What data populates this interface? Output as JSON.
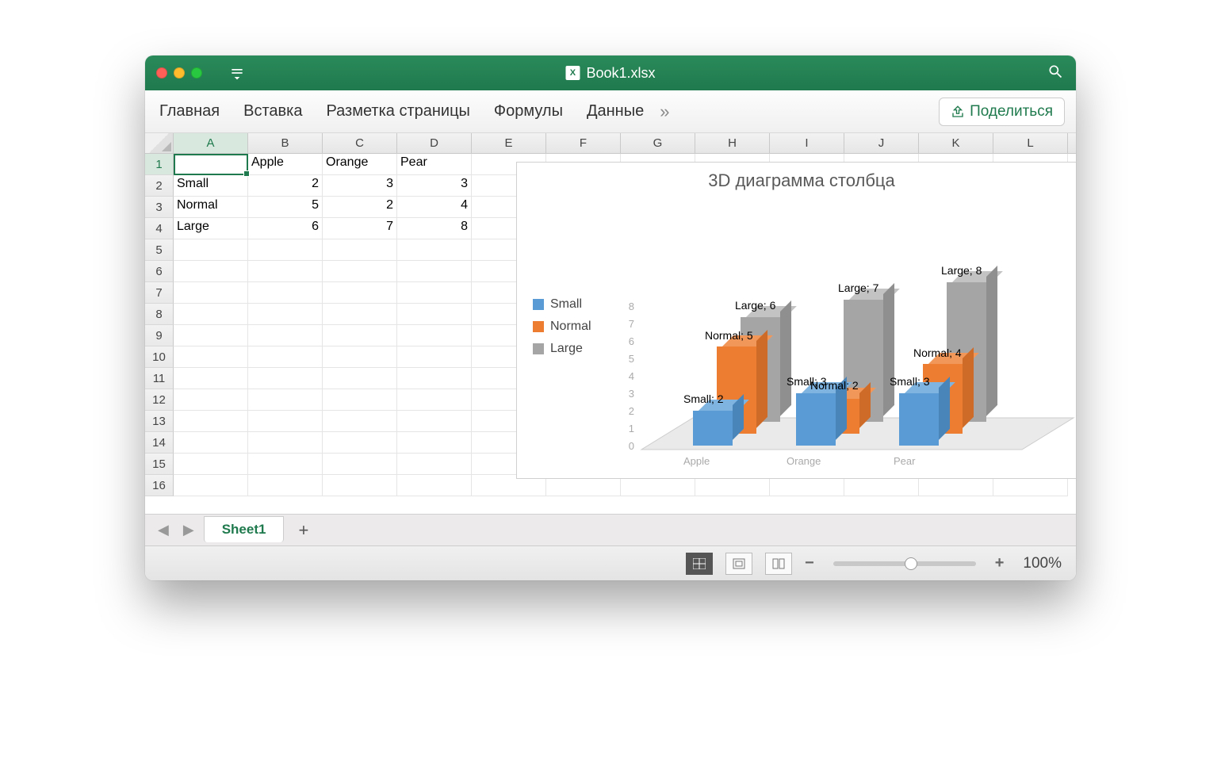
{
  "window": {
    "title": "Book1.xlsx"
  },
  "ribbon": {
    "tabs": [
      "Главная",
      "Вставка",
      "Разметка страницы",
      "Формулы",
      "Данные"
    ],
    "more": "»",
    "share": "Поделиться"
  },
  "columns": [
    "A",
    "B",
    "C",
    "D",
    "E",
    "F",
    "G",
    "H",
    "I",
    "J",
    "K",
    "L"
  ],
  "rows": [
    "1",
    "2",
    "3",
    "4",
    "5",
    "6",
    "7",
    "8",
    "9",
    "10",
    "11",
    "12",
    "13",
    "14",
    "15",
    "16"
  ],
  "data": {
    "B1": "Apple",
    "C1": "Orange",
    "D1": "Pear",
    "A2": "Small",
    "B2": "2",
    "C2": "3",
    "D2": "3",
    "A3": "Normal",
    "B3": "5",
    "C3": "2",
    "D3": "4",
    "A4": "Large",
    "B4": "6",
    "C4": "7",
    "D4": "8"
  },
  "sheet_tabs": {
    "active": "Sheet1"
  },
  "status": {
    "zoom": "100%"
  },
  "legend": [
    "Small",
    "Normal",
    "Large"
  ],
  "colors": {
    "small": "#5B9BD5",
    "small_dark": "#4a85b9",
    "small_darker": "#3d6e99",
    "normal": "#ED7D31",
    "normal_dark": "#cf6b28",
    "normal_darker": "#b05a20",
    "large": "#A5A5A5",
    "large_dark": "#8f8f8f",
    "large_darker": "#787878"
  },
  "chart_data": {
    "type": "bar",
    "title": "3D диаграмма столбца",
    "categories": [
      "Apple",
      "Orange",
      "Pear"
    ],
    "series": [
      {
        "name": "Small",
        "values": [
          2,
          3,
          3
        ]
      },
      {
        "name": "Normal",
        "values": [
          5,
          2,
          4
        ]
      },
      {
        "name": "Large",
        "values": [
          6,
          7,
          8
        ]
      }
    ],
    "ylim": [
      0,
      8
    ],
    "yticks": [
      0,
      1,
      2,
      3,
      4,
      5,
      6,
      7,
      8
    ],
    "data_labels": [
      "Small; 2",
      "Small; 3",
      "Small; 3",
      "Normal; 5",
      "Normal; 2",
      "Normal; 4",
      "Large; 6",
      "Large; 7",
      "Large; 8"
    ],
    "xlabel": "",
    "ylabel": ""
  }
}
